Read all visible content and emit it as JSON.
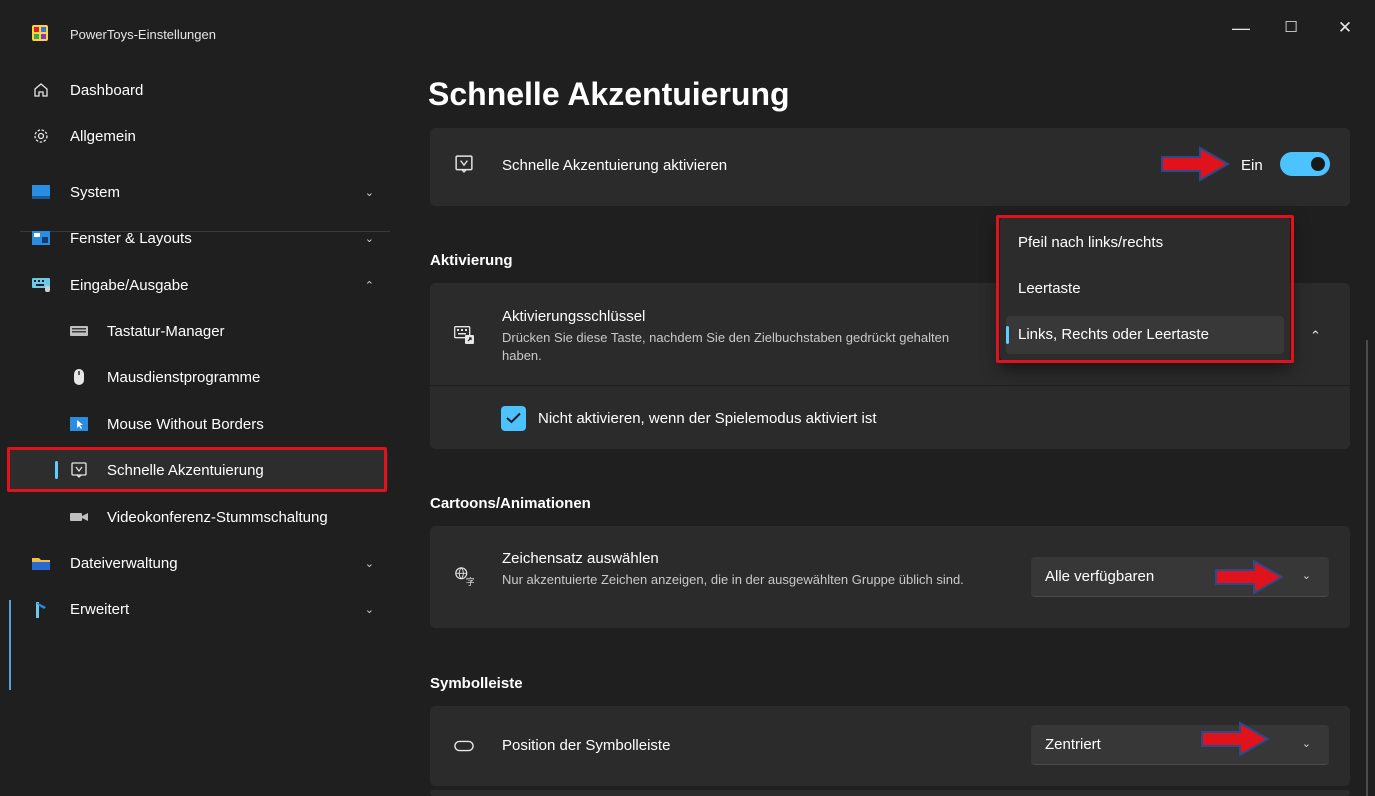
{
  "window": {
    "title": "PowerToys-Einstellungen",
    "minimize": "—",
    "maximize": "☐",
    "close": "✕"
  },
  "sidebar": {
    "items": [
      {
        "label": "Dashboard",
        "icon": "home-icon"
      },
      {
        "label": "Allgemein",
        "icon": "gear-icon"
      },
      {
        "label": "System",
        "icon": "monitor-icon",
        "expanded": false
      },
      {
        "label": "Fenster & Layouts",
        "icon": "window-layout-icon",
        "expanded": false
      },
      {
        "label": "Eingabe/Ausgabe",
        "icon": "keyboard-mouse-icon",
        "expanded": true
      },
      {
        "label": "Tastatur-Manager",
        "icon": "keyboard-icon"
      },
      {
        "label": "Mausdienstprogramme",
        "icon": "mouse-icon"
      },
      {
        "label": "Mouse Without Borders",
        "icon": "mouse-without-borders-icon"
      },
      {
        "label": "Schnelle Akzentuierung",
        "icon": "quick-accent-icon",
        "selected": true
      },
      {
        "label": "Videokonferenz-Stummschaltung",
        "icon": "camera-icon"
      },
      {
        "label": "Dateiverwaltung",
        "icon": "folder-icon",
        "expanded": false
      },
      {
        "label": "Erweitert",
        "icon": "tools-icon",
        "expanded": false
      }
    ]
  },
  "main": {
    "title": "Schnelle Akzentuierung",
    "enable": {
      "title": "Schnelle Akzentuierung aktivieren",
      "state_label": "Ein",
      "on": true
    },
    "activation": {
      "section": "Aktivierung",
      "key_title": "Aktivierungsschlüssel",
      "key_desc": "Drücken Sie diese Taste, nachdem Sie den Zielbuchstaben gedrückt gehalten haben.",
      "checkbox_label": "Nicht aktivieren, wenn der Spielemodus aktiviert ist",
      "checkbox_checked": true,
      "options": [
        "Pfeil nach links/rechts",
        "Leertaste",
        "Links, Rechts oder Leertaste"
      ],
      "selected_option": "Links, Rechts oder Leertaste"
    },
    "cartoons": {
      "section": "Cartoons/Animationen",
      "charset_title": "Zeichensatz auswählen",
      "charset_desc": "Nur akzentuierte Zeichen anzeigen, die in der ausgewählten Gruppe üblich sind.",
      "charset_value": "Alle verfügbaren"
    },
    "toolbar": {
      "section": "Symbolleiste",
      "position_title": "Position der Symbolleiste",
      "position_value": "Zentriert"
    }
  },
  "colors": {
    "accent": "#4cc2ff",
    "highlight_box": "#e0121b",
    "arrow_fill": "#e0121b",
    "arrow_outline": "#2a4a8a"
  }
}
